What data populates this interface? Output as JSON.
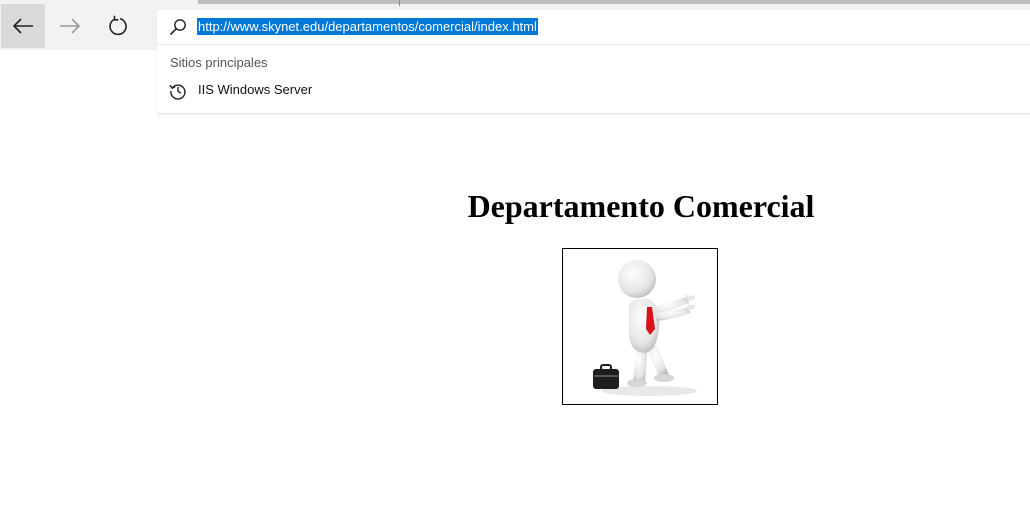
{
  "browser": {
    "address_bar": {
      "url": "http://www.skynet.edu/departamentos/comercial/index.html",
      "selected": true,
      "selection_color": "#0078d7"
    },
    "suggestions": {
      "header": "Sitios principales",
      "items": [
        {
          "label": "IIS Windows Server",
          "icon": "history-icon"
        }
      ]
    },
    "nav": {
      "back_icon": "back-arrow-icon",
      "forward_icon": "forward-arrow-icon",
      "refresh_icon": "refresh-icon"
    }
  },
  "page": {
    "heading": "Departamento Comercial",
    "image": {
      "subject": "3D white figure in red tie pointing, with briefcase"
    }
  }
}
